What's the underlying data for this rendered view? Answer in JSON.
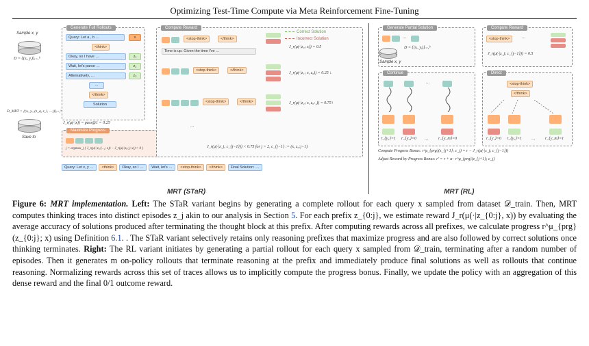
{
  "header": {
    "title": "Optimizing Test-Time Compute via Meta Reinforcement Fine-Tuning"
  },
  "figure": {
    "labels": {
      "left": "MRT (STaR)",
      "right": "MRT (RL)",
      "sample_xy": "Sample x, y",
      "dataset_D": "D = {(xᵢ, yᵢ)}ᵢ₌₁ᵇ",
      "dataset_Dmrt": "D_MRT = {(xᵢ, yᵢ, (z_q, z_l, …))}ᵢ₌₁ᵇ",
      "save_to": "Save to",
      "gen_full": "Generate Full Rollouts",
      "max_prog": "Maximize Progress",
      "compute_reward": "Compute Reward",
      "gen_partial": "Generate Partial Solution",
      "continue": "Continue",
      "direct": "Direct"
    },
    "star_rollout": {
      "query": "Query: Let a , b …",
      "think_open": "<think>",
      "line1": "Okay, so I have …",
      "line2": "Wait, let's parse …",
      "line3": "Alternatively, …",
      "dots": "…",
      "think_close": "</think>",
      "solution": "Solution",
      "x_token": "x",
      "z_tokens": [
        "z₁",
        "z₂",
        "z₃"
      ],
      "Jmu_pass": "J_r(μ(·|x)) = pass@1 = 0.25",
      "argmax": "j = argmax_j { J_r(μ(·|z₀:j₋₁; x)) − J_r(μ(·|z₀:j; x)) > 0 }",
      "strip_query": "Query: Let x, y …",
      "strip_think": "<think>",
      "strip_okay": "Okay, so I …",
      "strip_wait": "Wait, let's …",
      "strip_stop": "<stop-think>",
      "strip_thinkclose": "</think>",
      "strip_final": "Final Solution: …"
    },
    "reward_panel": {
      "stop_think": "<stop-think>",
      "think_close": "</think>",
      "timeup": "Time is up. Given the time I've …",
      "r1": "J_r(μ(·|z₀; x)) = 0.5",
      "r2": "J_r(μ(·|z₁; x, z₀)) = 0.25 ↓",
      "r3": "J_r(μ(·|z₂; x, z₀:₁)) = 0.75↑",
      "r4": "J_r(μ(·|z_j; c_{j−1})) < 0.75 for j > 2, c_{j−1} := (x, z₀:j−1)",
      "legend_correct": "Correct Solution",
      "legend_incorrect": "Incorrect Solution"
    },
    "rl_panel": {
      "D_partial": "D = {(xᵢ, yᵢ)}ᵢ₌₁ᵇ",
      "sample_xy": "Sample x, y",
      "Jr_half": "J_r(μ(·|z_j; c_{j−1})) = 0.5",
      "r_labels": [
        "r_{y₁}=1",
        "r_{y₂}=0",
        "…",
        "r_{y_m}=0",
        "r_{y₁}=0",
        "r_{y₂}=1",
        "…",
        "r_{y_m}=1"
      ],
      "compute_prog": "Compute Progress Bonus: r^μ_{prg}(z_{j+1}; c_j) = r − J_r(μ(·|z_j; c_{j−1}))",
      "adjust": "Adjust Reward by Progress Bonus: r′ = r + α · r^μ_{prg}(z_{j+1}; c_j)"
    }
  },
  "caption": {
    "fig_no": "Figure 6:",
    "title": "MRT implementation.",
    "left_label": "Left:",
    "left_text_a": "The STaR variant begins by generating a complete rollout for each query x sampled from dataset 𝒟_train. Then, MRT computes thinking traces into distinct episodes z_j akin to our analysis in Section ",
    "section_ref": "5",
    "left_text_b": ". For each prefix z_{0:j}, we estimate reward J_r(μ(·|z_{0:j}, x)) by evaluating the average accuracy of solutions produced after terminating the thought block at this prefix. After computing rewards across all prefixes, we calculate progress r^μ_{prg}(z_{0:j}; x) using Definition ",
    "def_ref": "6.1",
    "left_text_c": ". The STaR variant selectively retains only reasoning prefixes that maximize progress and are also followed by correct solutions once thinking terminates.",
    "right_label": "Right:",
    "right_text": "The RL variant initiates by generating a partial rollout for each query x sampled from 𝒟_train, terminating after a random number of episodes. Then it generates m on-policy rollouts that terminate reasoning at the prefix and immediately produce final solutions as well as rollouts that continue reasoning. Normalizing rewards across this set of traces allows us to implicitly compute the progress bonus. Finally, we update the policy with an aggregation of this dense reward and the final 0/1 outcome reward."
  }
}
